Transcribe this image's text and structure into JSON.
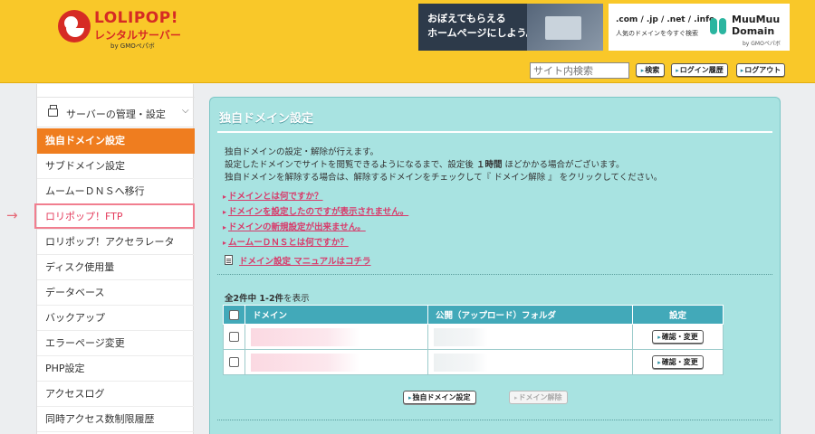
{
  "header": {
    "logo_text": "LOLIPOP!",
    "logo_sub": "レンタルサーバー",
    "logo_by": "by GMOペパボ",
    "banner1_line1": "おぼえてもらえる",
    "banner1_line2": "ホームページにしよう。",
    "banner2_tld": ".com / .jp / .net / .info",
    "banner2_tagline": "人気のドメインを今すぐ検索",
    "banner2_brand1": "MuuMuu",
    "banner2_brand2": "Domain",
    "banner2_by": "by GMOペパボ",
    "search_placeholder": "サイト内検索",
    "search_button": "検索",
    "login_history_button": "ログイン履歴",
    "logout_button": "ログアウト"
  },
  "sidebar": {
    "section_title": "サーバーの管理・設定",
    "items": [
      {
        "label": "独自ドメイン設定"
      },
      {
        "label": "サブドメイン設定"
      },
      {
        "label": "ムームーＤＮＳへ移行"
      },
      {
        "label": "ロリポップ！FTP"
      },
      {
        "label": "ロリポップ！アクセラレータ"
      },
      {
        "label": "ディスク使用量"
      },
      {
        "label": "データベース"
      },
      {
        "label": "バックアップ"
      },
      {
        "label": "エラーページ変更"
      },
      {
        "label": "PHP設定"
      },
      {
        "label": "アクセスログ"
      },
      {
        "label": "同時アクセス数制限履歴"
      }
    ]
  },
  "main": {
    "title": "独自ドメイン設定",
    "intro1": "独自ドメインの設定・解除が行えます。",
    "intro2_pre": "設定したドメインでサイトを閲覧できるようになるまで、設定後 ",
    "intro2_bold": "１時間",
    "intro2_post": " ほどかかる場合がございます。",
    "intro3": "独自ドメインを解除する場合は、解除するドメインをチェックして『 ドメイン解除 』 をクリックしてください。",
    "links": [
      "ドメインとは何ですか？",
      "ドメインを設定したのですが表示されません。",
      "ドメインの新規設定が出来ません。",
      "ムームーＤＮＳとは何ですか？"
    ],
    "manual_link": "ドメイン設定 マニュアルはコチラ",
    "count_bold": "全2件中 1-2件",
    "count_post": "を表示",
    "table": {
      "col_domain": "ドメイン",
      "col_folder": "公開（アップロード）フォルダ",
      "col_settings": "設定",
      "rows": [
        {
          "button": "確認・変更"
        },
        {
          "button": "確認・変更"
        }
      ]
    },
    "add_button": "独自ドメイン設定",
    "remove_button": "ドメイン解除"
  }
}
